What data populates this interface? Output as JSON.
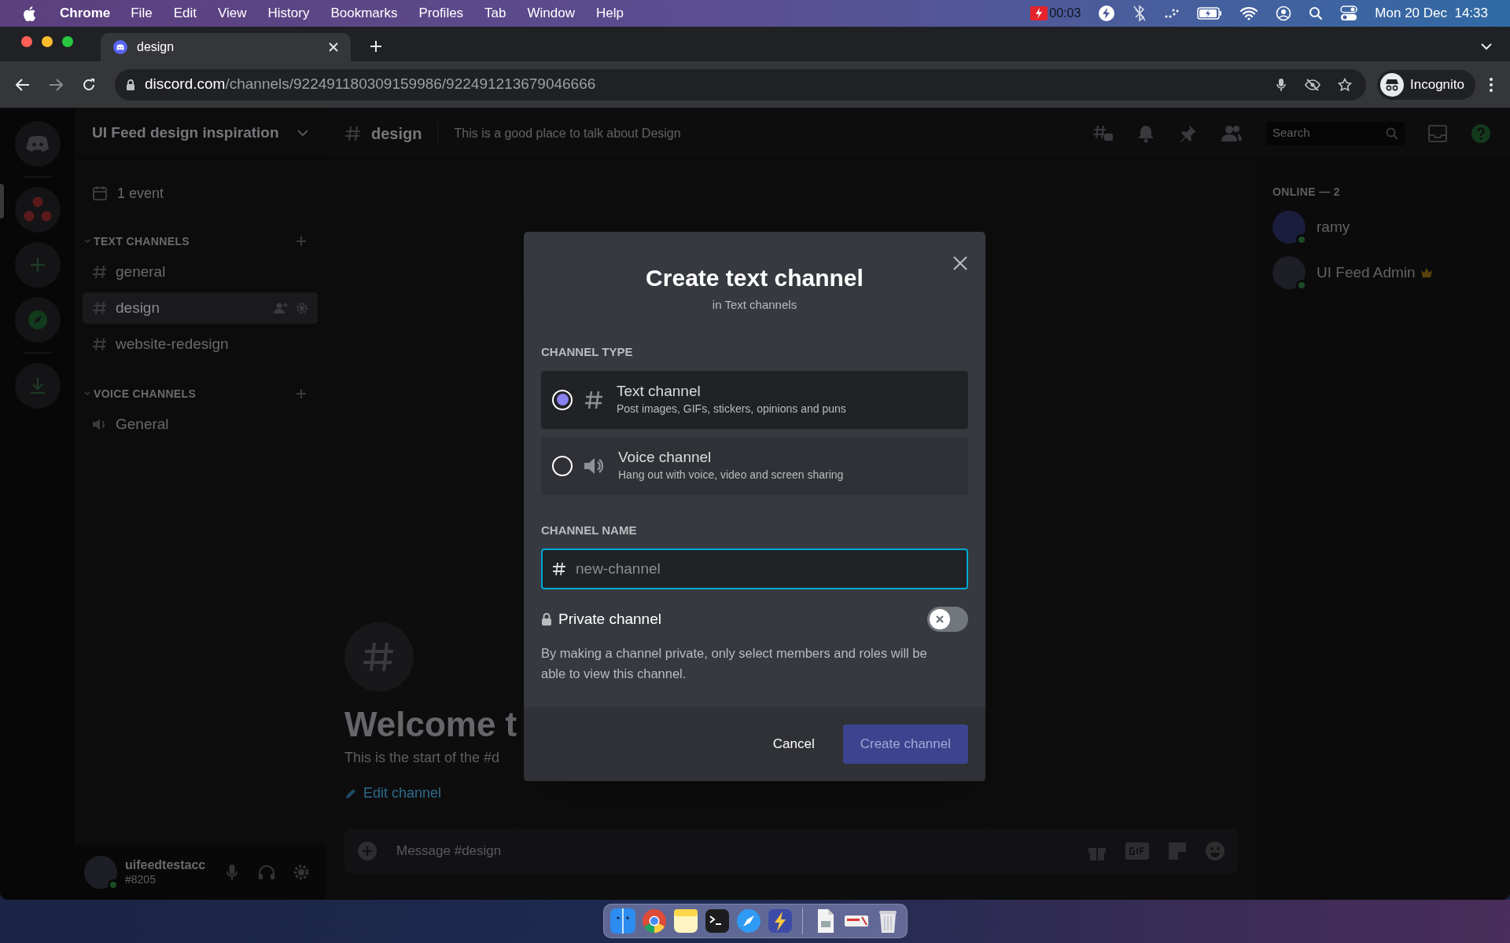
{
  "menu_bar": {
    "app": "Chrome",
    "menus": [
      "File",
      "Edit",
      "View",
      "History",
      "Bookmarks",
      "Profiles",
      "Tab",
      "Window",
      "Help"
    ],
    "recording": "00:03",
    "clock": "Mon 20 Dec  14:33"
  },
  "browser": {
    "tab_title": "design",
    "url_host": "discord.com",
    "url_path": "/channels/922491180309159986/922491213679046666",
    "profile": "Incognito"
  },
  "discord": {
    "server_name": "UI Feed design inspiration",
    "events": "1 event",
    "categories": [
      {
        "name": "TEXT CHANNELS",
        "channels": [
          {
            "name": "general",
            "kind": "text",
            "selected": false
          },
          {
            "name": "design",
            "kind": "text",
            "selected": true
          },
          {
            "name": "website-redesign",
            "kind": "text",
            "selected": false
          }
        ]
      },
      {
        "name": "VOICE CHANNELS",
        "channels": [
          {
            "name": "General",
            "kind": "voice",
            "selected": false
          }
        ]
      }
    ],
    "user": {
      "name": "uifeedtestacc",
      "tag": "#8205"
    },
    "header": {
      "channel": "design",
      "topic": "This is a good place to talk about Design",
      "search_placeholder": "Search"
    },
    "welcome": {
      "title": "Welcome t",
      "text": "This is the start of the #d",
      "edit_link": "Edit channel"
    },
    "composer": {
      "placeholder": "Message #design"
    },
    "members": {
      "heading": "ONLINE — 2",
      "list": [
        {
          "name": "ramy",
          "owner": false
        },
        {
          "name": "UI Feed Admin",
          "owner": true
        }
      ]
    }
  },
  "modal": {
    "title": "Create text channel",
    "subtitle": "in Text channels",
    "type_label": "CHANNEL TYPE",
    "types": [
      {
        "kind": "text",
        "title": "Text channel",
        "description": "Post images, GIFs, stickers, opinions and puns",
        "selected": true
      },
      {
        "kind": "voice",
        "title": "Voice channel",
        "description": "Hang out with voice, video and screen sharing",
        "selected": false
      }
    ],
    "name_label": "CHANNEL NAME",
    "name_field": {
      "placeholder": "new-channel"
    },
    "private": {
      "label": "Private channel",
      "on": false,
      "description": "By making a channel private, only select members and roles will be able to view this channel."
    },
    "cancel": "Cancel",
    "create": {
      "label": "Create channel",
      "disabled": true
    }
  }
}
